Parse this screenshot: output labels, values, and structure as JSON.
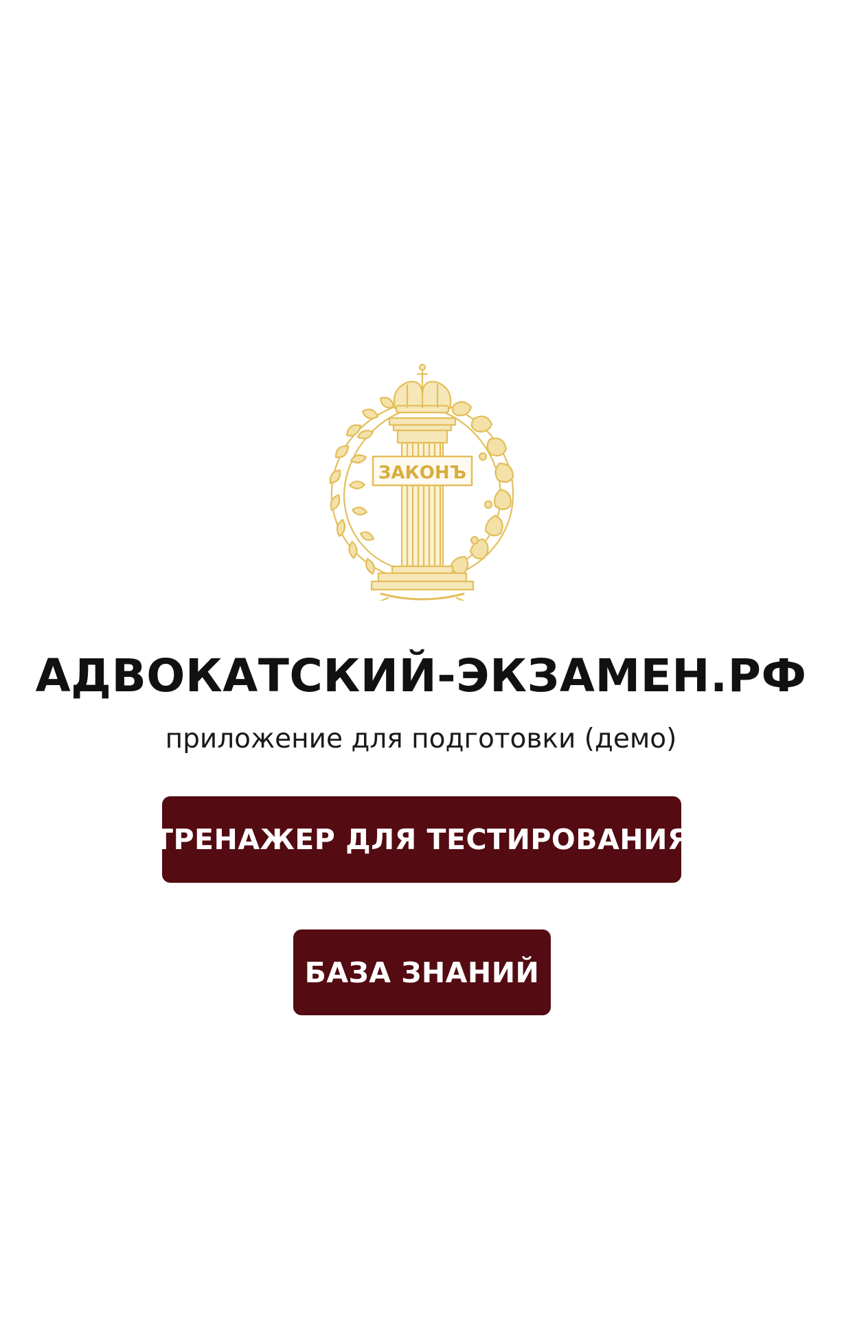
{
  "emblem": {
    "label": "ЗАКОНЪ",
    "icon": "law-column-emblem-icon",
    "color": "#e3be5a"
  },
  "header": {
    "title": "АДВОКАТСКИЙ-ЭКЗАМЕН.РФ",
    "subtitle": "приложение для подготовки (демо)"
  },
  "buttons": {
    "trainer_label": "ТРЕНАЖЕР ДЛЯ ТЕСТИРОВАНИЯ",
    "knowledge_label": "БАЗА ЗНАНИЙ"
  },
  "colors": {
    "button_bg": "#540b12",
    "button_text": "#ffffff",
    "emblem_gold": "#e3be5a"
  }
}
